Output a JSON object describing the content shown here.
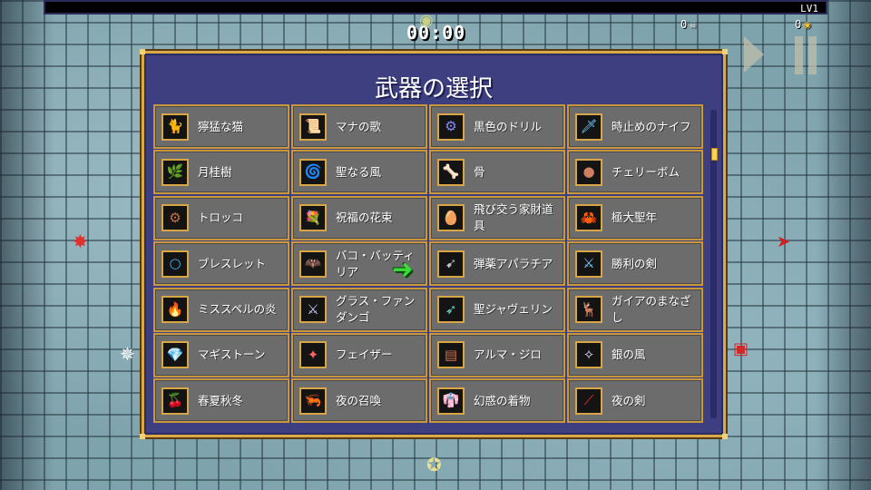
{
  "hud": {
    "level": "LV1",
    "timer": "00:00",
    "kills": "0",
    "gold": "0"
  },
  "panel": {
    "title": "武器の選択"
  },
  "weapons": [
    {
      "label": "獰猛な猫",
      "icon": "cat-icon",
      "glyph": "🐈",
      "color": "#f0e6c0"
    },
    {
      "label": "マナの歌",
      "icon": "scroll-icon",
      "glyph": "📜",
      "color": "#e8d9a0"
    },
    {
      "label": "黒色のドリル",
      "icon": "drill-icon",
      "glyph": "⚙",
      "color": "#8a8aff"
    },
    {
      "label": "時止めのナイフ",
      "icon": "knife-icon",
      "glyph": "🗡",
      "color": "#6cd0ff"
    },
    {
      "label": "月桂樹",
      "icon": "laurel-icon",
      "glyph": "🌿",
      "color": "#7fd060"
    },
    {
      "label": "聖なる風",
      "icon": "wind-icon",
      "glyph": "🌀",
      "color": "#a0c8ff"
    },
    {
      "label": "骨",
      "icon": "bone-icon",
      "glyph": "🦴",
      "color": "#ffffff"
    },
    {
      "label": "チェリーボム",
      "icon": "cherry-bomb-icon",
      "glyph": "●",
      "color": "#d08060"
    },
    {
      "label": "トロッコ",
      "icon": "cart-wheel-icon",
      "glyph": "⚙",
      "color": "#c07040"
    },
    {
      "label": "祝福の花束",
      "icon": "bouquet-icon",
      "glyph": "💐",
      "color": "#ff80a0"
    },
    {
      "label": "飛び交う家財道具",
      "icon": "egg-icon",
      "glyph": "🥚",
      "color": "#ffffff"
    },
    {
      "label": "極大聖年",
      "icon": "crab-icon",
      "glyph": "🦀",
      "color": "#ff5050"
    },
    {
      "label": "ブレスレット",
      "icon": "bracelet-icon",
      "glyph": "○",
      "color": "#40b0ff"
    },
    {
      "label": "バコ・バッティリア",
      "icon": "bat-icon",
      "glyph": "🦇",
      "color": "#c04040"
    },
    {
      "label": "弾薬アパラチア",
      "icon": "ammo-icon",
      "glyph": "➹",
      "color": "#c0c0d0"
    },
    {
      "label": "勝利の剣",
      "icon": "sword-icon",
      "glyph": "⚔",
      "color": "#80d0ff"
    },
    {
      "label": "ミススペルの炎",
      "icon": "fire-icon",
      "glyph": "🔥",
      "color": "#ff8030"
    },
    {
      "label": "グラス・ファンダンゴ",
      "icon": "sword-icon",
      "glyph": "⚔",
      "color": "#d0d0ff"
    },
    {
      "label": "聖ジャヴェリン",
      "icon": "javelin-icon",
      "glyph": "➶",
      "color": "#70e0d0"
    },
    {
      "label": "ガイアのまなざし",
      "icon": "deer-icon",
      "glyph": "🦌",
      "color": "#80ffc0"
    },
    {
      "label": "マギストーン",
      "icon": "gem-icon",
      "glyph": "💎",
      "color": "#ffd040"
    },
    {
      "label": "フェイザー",
      "icon": "phaser-icon",
      "glyph": "✦",
      "color": "#ff6060"
    },
    {
      "label": "アルマ・ジロ",
      "icon": "cabinet-icon",
      "glyph": "▤",
      "color": "#d07050"
    },
    {
      "label": "銀の風",
      "icon": "wind-icon",
      "glyph": "✧",
      "color": "#e0e0ff"
    },
    {
      "label": "春夏秋冬",
      "icon": "berries-icon",
      "glyph": "🍒",
      "color": "#ff60a0"
    },
    {
      "label": "夜の召喚",
      "icon": "shrimp-icon",
      "glyph": "🦐",
      "color": "#ff9070"
    },
    {
      "label": "幻惑の着物",
      "icon": "kimono-icon",
      "glyph": "👘",
      "color": "#ff4040"
    },
    {
      "label": "夜の剣",
      "icon": "scythe-icon",
      "glyph": "⟋",
      "color": "#ff3030"
    }
  ]
}
